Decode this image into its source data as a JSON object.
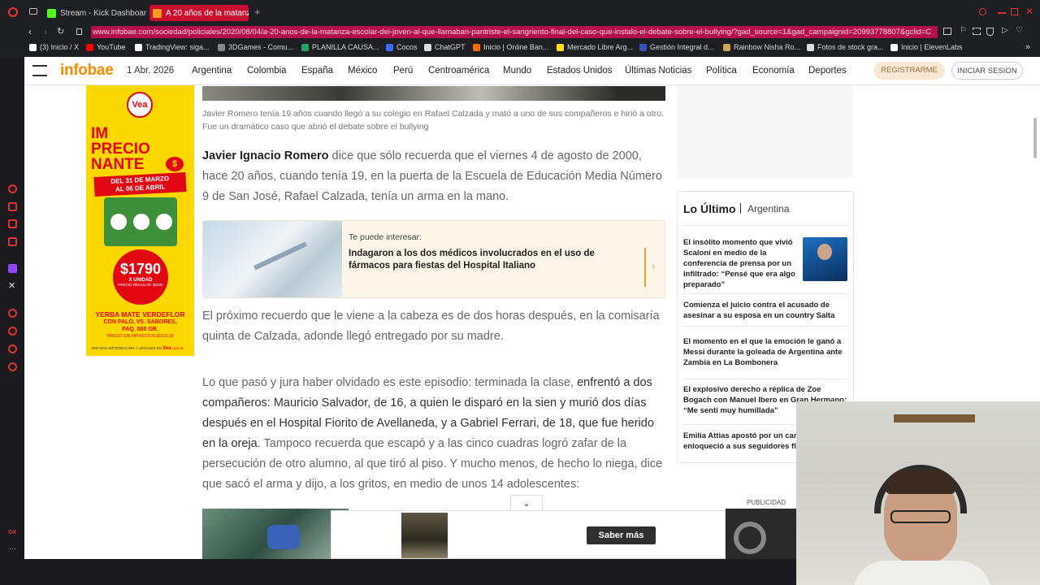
{
  "browser": {
    "tabs": [
      {
        "label": "Stream - Kick Dashboard",
        "active": false
      },
      {
        "label": "A 20 años de la matanza e",
        "active": true
      }
    ],
    "new_tab_label": "+",
    "url": "www.infobae.com/sociedad/policiales/2020/08/04/a-20-anos-de-la-matanza-escolar-del-joven-al-que-llamaban-pantriste-el-sangriento-final-del-caso-que-instalo-el-debate-sobre-el-bullying/?gad_source=1&gad_campaignid=20993778807&gclid=C",
    "bookmarks": [
      {
        "label": "(3) Inicio / X",
        "color": "#ffffff"
      },
      {
        "label": "YouTube",
        "color": "#ff0000"
      },
      {
        "label": "TradingView: siga...",
        "color": "#ffffff"
      },
      {
        "label": "3DGames - Comu...",
        "color": "#888888"
      },
      {
        "label": "PLANILLA CAUSA...",
        "color": "#1fa463"
      },
      {
        "label": "Cocos",
        "color": "#3b6cff"
      },
      {
        "label": "ChatGPT",
        "color": "#dddddd"
      },
      {
        "label": "Inicio | Online Ban...",
        "color": "#ff6a00"
      },
      {
        "label": "Mercado Libre Arg...",
        "color": "#ffe600"
      },
      {
        "label": "Gestión Integral d...",
        "color": "#3a4fbf"
      },
      {
        "label": "Rainbow Nisha Ro...",
        "color": "#cfa75a"
      },
      {
        "label": "Fotos de stock gra...",
        "color": "#dddddd"
      },
      {
        "label": "Inicio | ElevenLabs",
        "color": "#ffffff"
      }
    ]
  },
  "header": {
    "logo": "infobae",
    "date": "1 Abr, 2026",
    "nav": [
      "Argentina",
      "Colombia",
      "España",
      "México",
      "Perú",
      "Centroamérica",
      "Mundo",
      "Estados Unidos",
      "Últimas Noticias",
      "Política",
      "Economía",
      "Deportes"
    ],
    "register": "REGISTRARME",
    "login": "INICIAR SESION"
  },
  "ad": {
    "brand": "Vea",
    "headline1": "IM",
    "headline2": "PRECIO",
    "headline3": "NANTE",
    "dates1": "DEL 31 DE MARZO",
    "dates2": "AL 06 DE ABRIL",
    "price": "$1790",
    "unit": "X UNIDAD",
    "regular": "PRECIO REGULAR: $2200",
    "product": "YERBA MATE VERDEFLOR",
    "product2": "CON PALO, VS. SABORES,",
    "product3": "PAQ. 500 GR.",
    "product4": "PRECIO SIN IMPUESTOS $1610,18",
    "footer": "VER MÁS INFORMACIÓN Y LEGALES EN",
    "footer_site": ".com.ar"
  },
  "article": {
    "caption": "Javier Romero tenía 19 años cuando llegó a su colegio en Rafael Calzada y mató a uno de sus compañeros e hirió a otro. Fue un dramático caso que abrió el debate sobre el bullying",
    "p1_bold": "Javier Ignacio Romero",
    "p1_rest": " dice que sólo recuerda que el viernes 4 de agosto de 2000, hace 20 años, cuando tenía 19, en la puerta de la Escuela de Educación Media Número 9 de San José, Rafael Calzada, tenía un arma en la mano.",
    "related_kicker": "Te puede interesar:",
    "related_title": "Indagaron a los dos médicos involucrados en el uso de fármacos para fiestas del Hospital Italiano",
    "p2": "El próximo recuerdo que le viene a la cabeza es de dos horas después, en la comisaría quinta de Calzada, adonde llegó entregado por su madre.",
    "p3_a": "Lo que pasó y jura haber olvidado es este episodio: terminada la clase, ",
    "p3_b": "enfrentó a dos compañeros: Mauricio Salvador, de 16, a quien le disparó en la sien y murió dos días después en el Hospital Fiorito de Avellaneda, y a Gabriel Ferrari, de 18, que fue herido en la oreja",
    "p3_c": ". Tampoco recuerda que escapó y a las cinco cuadras logró zafar de la persecución de otro alumno, al que tiró al piso. Y mucho menos, de hecho lo niega, dice que sacó el arma y dijo, a los gritos, en medio de unos 14 adolescentes:"
  },
  "latest": {
    "title": "Lo Último",
    "section": "Argentina",
    "items": [
      "El insólito momento que vivió Scaloni en medio de la conferencia de prensa por un infiltrado: “Pensé que era algo preparado”",
      "Comienza el juicio contra el acusado de asesinar a su esposa en un country Salta",
      "El momento en el que la emoción le ganó a Messi durante la goleada de Argentina ante Zambia en La Bombonera",
      "El explosivo derecho a réplica de Zoe Bogach con Manuel Ibero en Gran Hermano: “Me sentí muy humillada”",
      "Emilia Attias apostó por un can que enloqueció a sus seguidores flequillo llegó”"
    ],
    "publicidad": "PUBLICIDAD"
  },
  "bottom_ad": {
    "cta": "Saber más"
  }
}
